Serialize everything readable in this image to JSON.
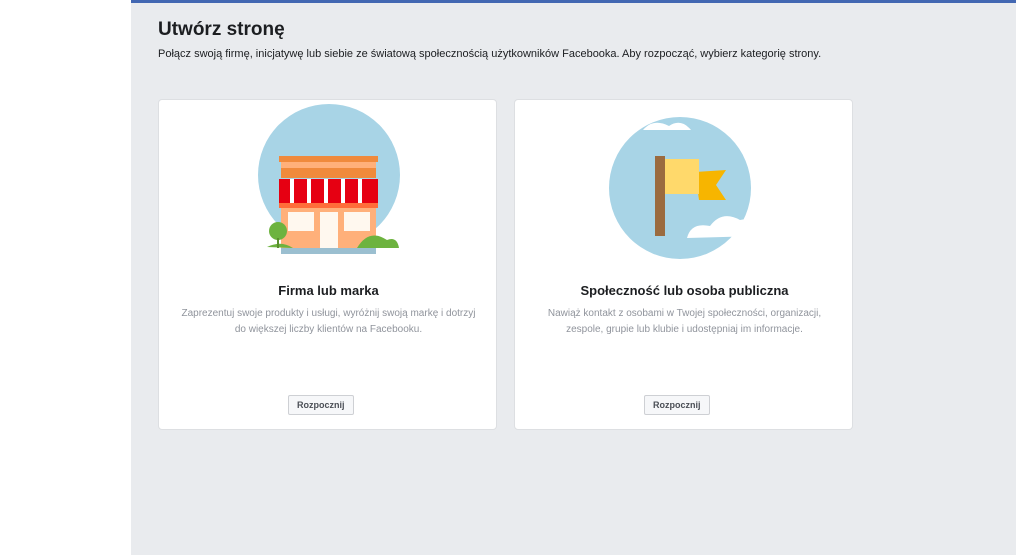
{
  "page": {
    "title": "Utwórz stronę",
    "subtitle": "Połącz swoją firmę, inicjatywę lub siebie ze światową społecznością użytkowników Facebooka. Aby rozpocząć, wybierz kategorię strony."
  },
  "cards": [
    {
      "title": "Firma lub marka",
      "description": "Zaprezentuj swoje produkty i usługi, wyróżnij swoją markę i dotrzyj do większej liczby klientów na Facebooku.",
      "button_label": "Rozpocznij",
      "icon": "storefront-icon"
    },
    {
      "title": "Społeczność lub osoba publiczna",
      "description": "Nawiąż kontakt z osobami w Twojej społeczności, organizacji, zespole, grupie lub klubie i udostępniaj im informacje.",
      "button_label": "Rozpocznij",
      "icon": "flag-icon"
    }
  ],
  "colors": {
    "background": "#e9ebee",
    "top_bar": "#4267b2",
    "card_bg": "#ffffff",
    "muted_text": "#90949c",
    "illustration_circle": "#a8d4e6"
  }
}
